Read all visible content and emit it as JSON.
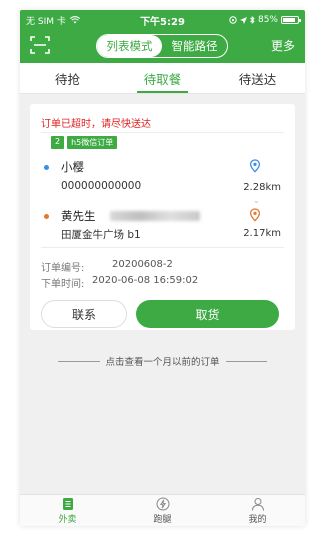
{
  "status_bar": {
    "carrier": "无 SIM 卡",
    "time": "下午5:29",
    "battery": "85%",
    "battery_level": 0.85
  },
  "header": {
    "seg_options": [
      "列表模式",
      "智能路径"
    ],
    "seg_active": 0,
    "more_label": "更多"
  },
  "tabs": [
    {
      "label": "待抢",
      "active": false
    },
    {
      "label": "待取餐",
      "active": true
    },
    {
      "label": "待送达",
      "active": false
    }
  ],
  "order": {
    "warning": "订单已超时，请尽快送达",
    "badge_num": "2",
    "badge_source": "h5微信订单",
    "pickup": {
      "name": "小樱",
      "phone": "000000000000",
      "distance": "2.28km"
    },
    "delivery": {
      "name": "黄先生",
      "address": "田厦金牛广场 b1",
      "distance": "2.17km"
    },
    "order_no_label": "订单编号:",
    "order_no": "20200608-2",
    "order_time_label": "下单时间:",
    "order_time": "2020-06-08 16:59:02",
    "contact_label": "联系",
    "pickup_label": "取货"
  },
  "history_link": "点击查看一个月以前的订单",
  "bottom_nav": [
    {
      "label": "外卖",
      "icon": "list-icon",
      "active": true
    },
    {
      "label": "跑腿",
      "icon": "bolt-icon",
      "active": false
    },
    {
      "label": "我的",
      "icon": "user-icon",
      "active": false
    }
  ],
  "colors": {
    "brand": "#3daa44",
    "warning": "#e02020",
    "pickup_pin": "#3a8ee6",
    "delivery_pin": "#e07a30"
  }
}
